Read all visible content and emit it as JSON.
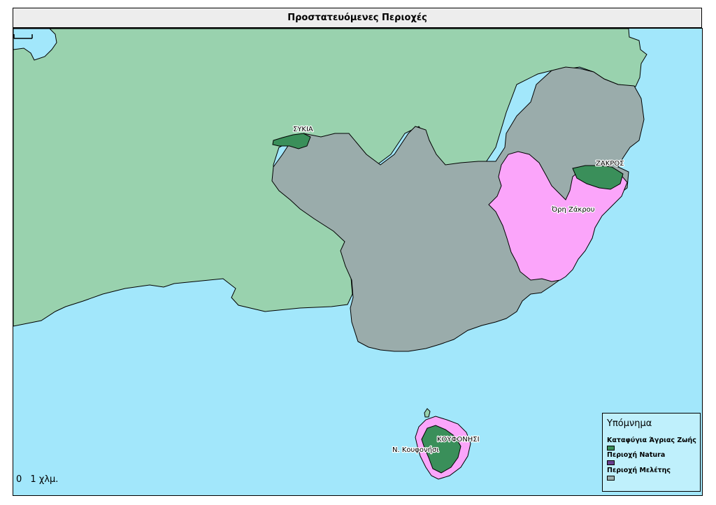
{
  "map": {
    "title": "Προστατευόμενες Περιοχές",
    "labels": {
      "sykia": "ΣΥΚΙΑ",
      "zakros": "ΖΑΚΡΟΣ",
      "ori_zakrou": "Όρη Ζάκρου",
      "koufonisi": "ΚΟΥΦΟΝΗΣΙ",
      "n_koufonisi": "Ν. Κουφονήσι"
    },
    "scale": {
      "zero": "0",
      "one": "1 χλμ."
    },
    "colors": {
      "sea": "#a2e7fb",
      "land": "#99d2ae",
      "study_area": "#9aacab",
      "natura": "#fba5fa",
      "wildlife_refuge": "#3a8f5a",
      "legend_natura_swatch": "#6a3f8f"
    }
  },
  "legend": {
    "title": "Υπόμνημα",
    "items": [
      {
        "label": "Καταφύγια Άγριας Ζωής",
        "color": "#3a8f5a"
      },
      {
        "label": "Περιοχή Natura",
        "color": "#6a3f8f"
      },
      {
        "label": "Περιοχή Μελέτης",
        "color": "#9aacab"
      }
    ]
  }
}
